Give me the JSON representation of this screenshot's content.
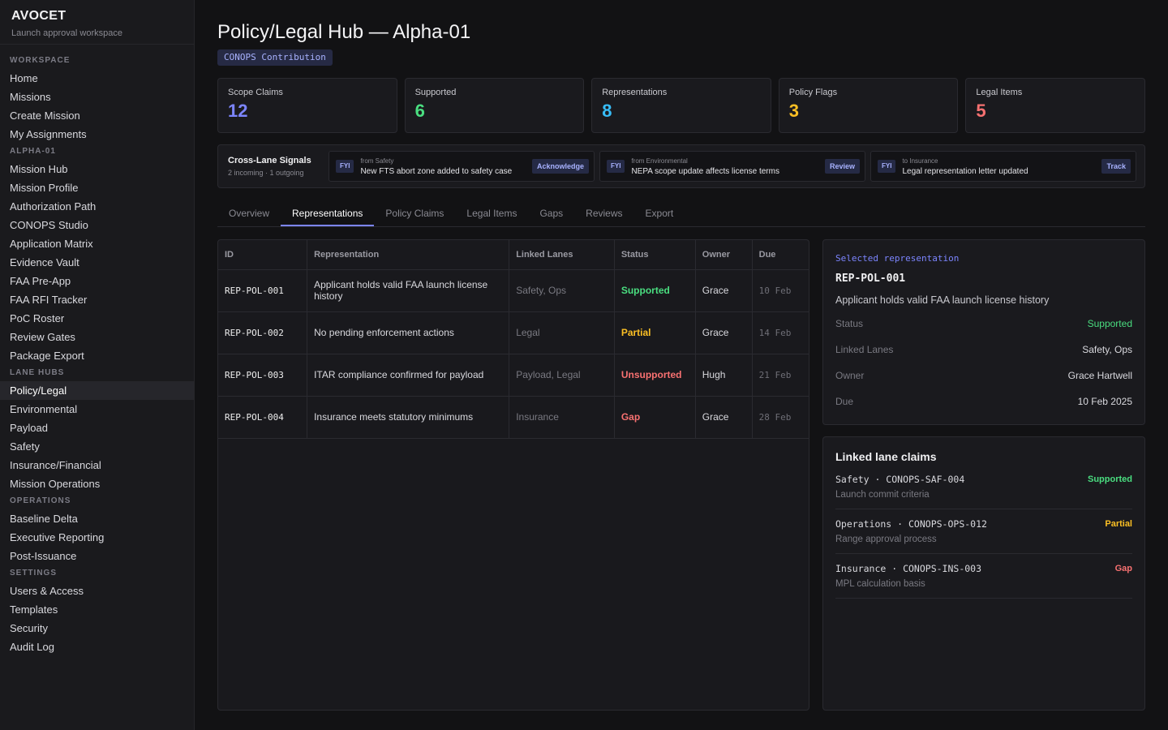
{
  "app": {
    "name": "AVOCET",
    "subtitle": "Launch approval workspace"
  },
  "sidebar": {
    "sections": [
      {
        "heading": "WORKSPACE",
        "items": [
          "Home",
          "Missions",
          "Create Mission",
          "My Assignments"
        ]
      },
      {
        "heading": "ALPHA-01",
        "items": [
          "Mission Hub",
          "Mission Profile",
          "Authorization Path",
          "CONOPS Studio",
          "Application Matrix",
          "Evidence Vault",
          "FAA Pre-App",
          "FAA RFI Tracker",
          "PoC Roster",
          "Review Gates",
          "Package Export"
        ]
      },
      {
        "heading": "LANE HUBS",
        "items": [
          "Policy/Legal",
          "Environmental",
          "Payload",
          "Safety",
          "Insurance/Financial",
          "Mission Operations"
        ]
      },
      {
        "heading": "OPERATIONS",
        "items": [
          "Baseline Delta",
          "Executive Reporting",
          "Post-Issuance"
        ]
      },
      {
        "heading": "SETTINGS",
        "items": [
          "Users & Access",
          "Templates",
          "Security",
          "Audit Log"
        ]
      }
    ],
    "active_item": "Policy/Legal"
  },
  "header": {
    "title": "Policy/Legal Hub — Alpha-01",
    "pill": "CONOPS Contribution"
  },
  "stats": [
    {
      "label": "Scope Claims",
      "value": "12",
      "color": "#7c85ff"
    },
    {
      "label": "Supported",
      "value": "6",
      "color": "#4ade80"
    },
    {
      "label": "Representations",
      "value": "8",
      "color": "#38bdf8"
    },
    {
      "label": "Policy Flags",
      "value": "3",
      "color": "#fbbf24"
    },
    {
      "label": "Legal Items",
      "value": "5",
      "color": "#f87171"
    }
  ],
  "signals": {
    "title": "Cross-Lane Signals",
    "subtitle": "2 incoming · 1 outgoing",
    "items": [
      {
        "tag": "FYI",
        "from": "from Safety",
        "message": "New FTS abort zone added to safety case",
        "action": "Acknowledge"
      },
      {
        "tag": "FYI",
        "from": "from Environmental",
        "message": "NEPA scope update affects license terms",
        "action": "Review"
      },
      {
        "tag": "FYI",
        "from": "to Insurance",
        "message": "Legal representation letter updated",
        "action": "Track"
      }
    ]
  },
  "tabs": [
    "Overview",
    "Representations",
    "Policy Claims",
    "Legal Items",
    "Gaps",
    "Reviews",
    "Export"
  ],
  "active_tab": "Representations",
  "table": {
    "columns": [
      "ID",
      "Representation",
      "Linked Lanes",
      "Status",
      "Owner",
      "Due"
    ],
    "rows": [
      {
        "id": "REP-POL-001",
        "representation": "Applicant holds valid FAA launch license history",
        "lanes": "Safety, Ops",
        "status": "Supported",
        "status_color": "#4ade80",
        "owner": "Grace",
        "due": "10 Feb"
      },
      {
        "id": "REP-POL-002",
        "representation": "No pending enforcement actions",
        "lanes": "Legal",
        "status": "Partial",
        "status_color": "#fbbf24",
        "owner": "Grace",
        "due": "14 Feb"
      },
      {
        "id": "REP-POL-003",
        "representation": "ITAR compliance confirmed for payload",
        "lanes": "Payload, Legal",
        "status": "Unsupported",
        "status_color": "#f87171",
        "owner": "Hugh",
        "due": "21 Feb"
      },
      {
        "id": "REP-POL-004",
        "representation": "Insurance meets statutory minimums",
        "lanes": "Insurance",
        "status": "Gap",
        "status_color": "#f87171",
        "owner": "Grace",
        "due": "28 Feb"
      }
    ]
  },
  "detail": {
    "eyebrow": "Selected representation",
    "id": "REP-POL-001",
    "description": "Applicant holds valid FAA launch license history",
    "fields": [
      {
        "key": "Status",
        "value": "Supported",
        "color": "#4ade80"
      },
      {
        "key": "Linked Lanes",
        "value": "Safety, Ops",
        "color": "#d9d9de"
      },
      {
        "key": "Owner",
        "value": "Grace Hartwell",
        "color": "#d9d9de"
      },
      {
        "key": "Due",
        "value": "10 Feb 2025",
        "color": "#d9d9de"
      }
    ]
  },
  "linked_claims": {
    "title": "Linked lane claims",
    "items": [
      {
        "ref": "Safety · CONOPS-SAF-004",
        "desc": "Launch commit criteria",
        "status": "Supported",
        "color": "#4ade80"
      },
      {
        "ref": "Operations · CONOPS-OPS-012",
        "desc": "Range approval process",
        "status": "Partial",
        "color": "#fbbf24"
      },
      {
        "ref": "Insurance · CONOPS-INS-003",
        "desc": "MPL calculation basis",
        "status": "Gap",
        "color": "#f87171"
      }
    ]
  }
}
